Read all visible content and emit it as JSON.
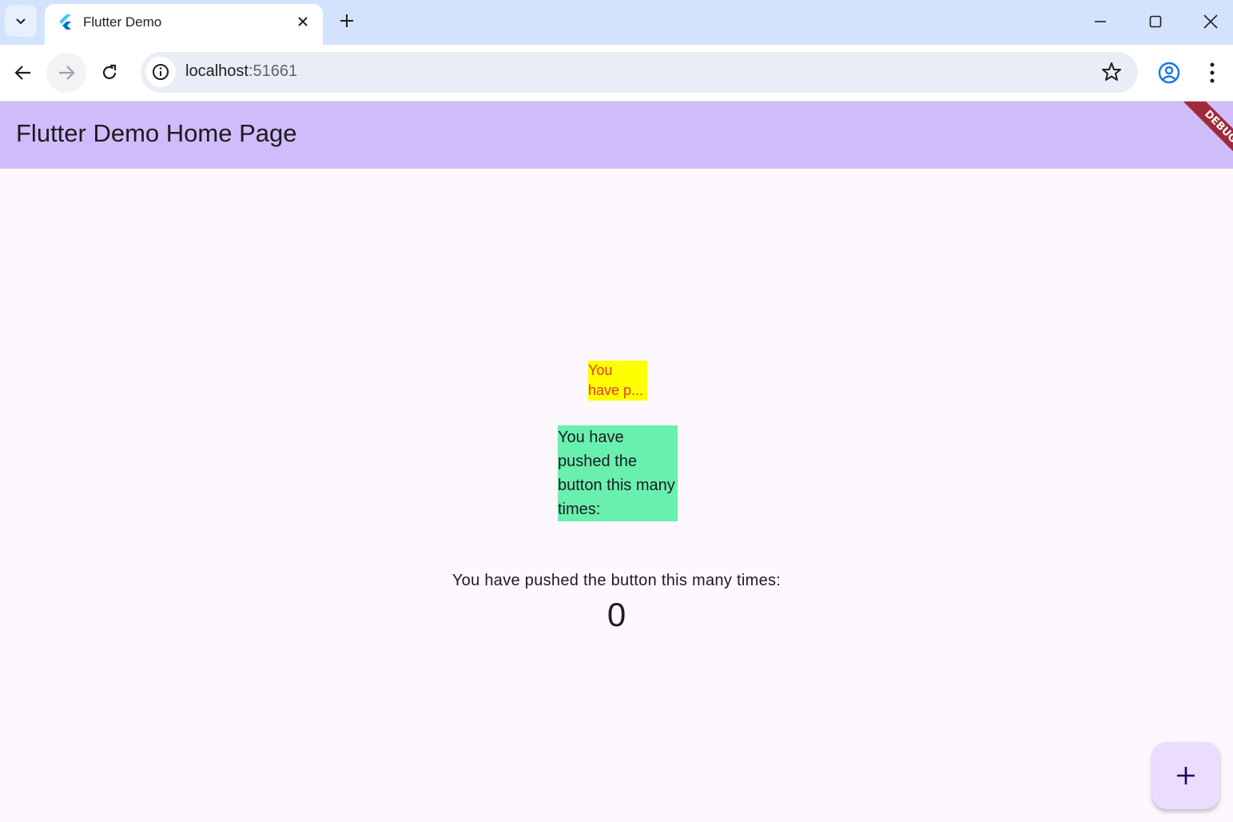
{
  "browser": {
    "tab": {
      "title": "Flutter Demo",
      "favicon": "flutter-logo-icon"
    },
    "url_host": "localhost",
    "url_port": ":51661",
    "icons": {
      "tab_search": "chevron-down-icon",
      "tab_close": "close-icon",
      "new_tab": "plus-icon",
      "minimize": "minimize-icon",
      "maximize": "maximize-icon",
      "close_window": "close-icon",
      "back": "arrow-left-icon",
      "forward": "arrow-right-icon",
      "reload": "reload-icon",
      "site_info": "info-icon",
      "bookmark": "star-icon",
      "profile": "account-icon",
      "menu": "more-vert-icon"
    }
  },
  "app": {
    "title": "Flutter Demo Home Page",
    "debug_banner": "DEBUG",
    "yellow_box": {
      "line1": "You",
      "line2": "have p..."
    },
    "green_box": {
      "text": "You have pushed the button this many times:"
    },
    "counter_label": "You have pushed the button this many times:",
    "counter_value": "0",
    "fab_icon": "plus-icon"
  },
  "colors": {
    "appbar": "#d1bcfb",
    "background": "#fdf7fe",
    "yellow_box": "#ffff00",
    "yellow_text": "#e53935",
    "green_box": "#69f0ae",
    "fab": "#eaddff",
    "debug_banner": "#a02a3a"
  }
}
